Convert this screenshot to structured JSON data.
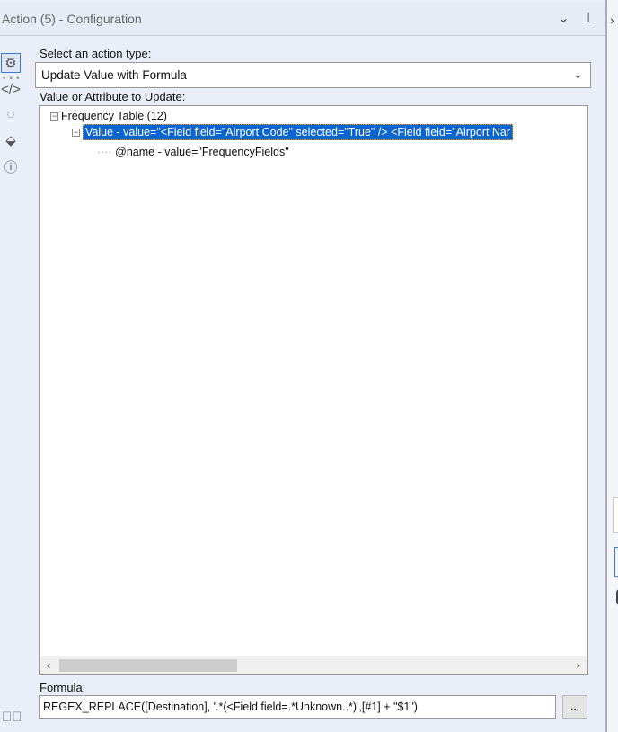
{
  "window": {
    "title": "Action (5) - Configuration"
  },
  "action_type": {
    "label": "Select an action type:",
    "value": "Update Value with Formula"
  },
  "tree": {
    "label": "Value or Attribute to Update:",
    "nodes": [
      {
        "text": "Frequency Table (12)"
      },
      {
        "text": "Value - value=\"<Field field=\"Airport Code\" selected=\"True\" /> <Field field=\"Airport Nar"
      },
      {
        "text": "@name - value=\"FrequencyFields\""
      }
    ]
  },
  "formula": {
    "label": "Formula:",
    "value": "REGEX_REPLACE([Destination], '.*(<Field field=.*Unknown..*)',[#1] + \"$1\")",
    "button": "..."
  }
}
